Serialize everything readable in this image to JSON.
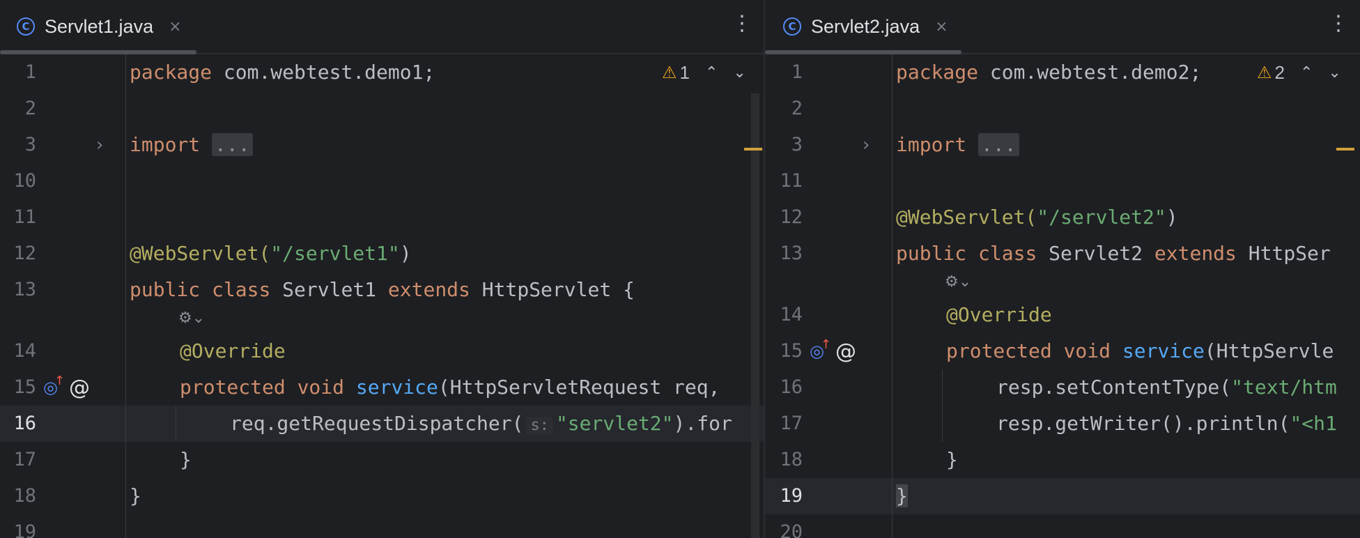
{
  "left": {
    "tab": {
      "icon": "class-c-icon",
      "title": "Servlet1.java",
      "close": "×"
    },
    "menu": "⋮",
    "warnings": {
      "count": "1",
      "up": "⌃",
      "down": "⌄"
    },
    "lines": [
      "1",
      "2",
      "3",
      "10",
      "11",
      "12",
      "13",
      "14",
      "15",
      "16",
      "17",
      "18",
      "19"
    ],
    "code": {
      "l1_kw": "package",
      "l1_rest": " com.webtest.demo1;",
      "l3_kw": "import",
      "l3_fold": "...",
      "l12_ann": "@WebServlet(",
      "l12_str": "\"/servlet1\"",
      "l12_end": ")",
      "l13_kw1": "public",
      "l13_kw2": "class",
      "l13_name": "Servlet1",
      "l13_kw3": "extends",
      "l13_rest": "HttpServlet {",
      "l14_ann": "@Override",
      "l15_kw1": "protected",
      "l15_kw2": "void",
      "l15_fn": "service",
      "l15_rest": "(HttpServletRequest req,",
      "l16_pre": "req.getRequestDispatcher(",
      "l16_hint": "s:",
      "l16_str": "\"servlet2\"",
      "l16_post": ").for",
      "l17": "}",
      "l18": "}"
    }
  },
  "right": {
    "tab": {
      "icon": "class-c-icon",
      "title": "Servlet2.java",
      "close": "×"
    },
    "menu": "⋮",
    "warnings": {
      "count": "2",
      "up": "⌃",
      "down": "⌄"
    },
    "lines": [
      "1",
      "2",
      "3",
      "11",
      "12",
      "13",
      "14",
      "15",
      "16",
      "17",
      "18",
      "19",
      "20"
    ],
    "code": {
      "l1_kw": "package",
      "l1_rest": " com.webtest.demo2;",
      "l3_kw": "import",
      "l3_fold": "...",
      "l12_ann": "@WebServlet(",
      "l12_str": "\"/servlet2\"",
      "l12_end": ")",
      "l13_kw1": "public",
      "l13_kw2": "class",
      "l13_name": "Servlet2",
      "l13_kw3": "extends",
      "l13_rest": "HttpSer",
      "l14_ann": "@Override",
      "l15_kw1": "protected",
      "l15_kw2": "void",
      "l15_fn": "service",
      "l15_rest": "(HttpServle",
      "l16_pre": "resp.setContentType(",
      "l16_str": "\"text/htm",
      "l17_pre": "resp.getWriter().println(",
      "l17_str": "\"<h1",
      "l18": "}",
      "l19": "}"
    }
  },
  "colors": {
    "keyword": "#cf8e6d",
    "string": "#6aab73",
    "annotation": "#b3ae60",
    "function": "#56a8f5",
    "warning": "#e5a11a"
  }
}
